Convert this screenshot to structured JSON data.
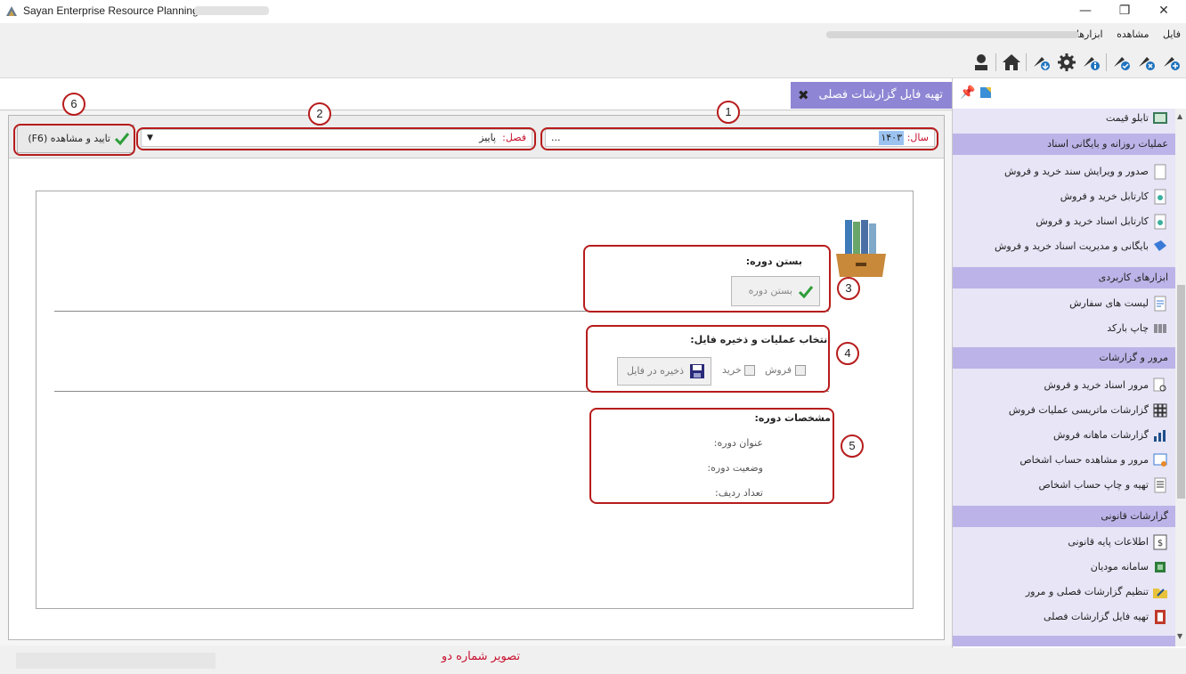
{
  "window": {
    "title": "Sayan Enterprise Resource Planning",
    "minimize": "—",
    "maximize": "❐",
    "close": "✕"
  },
  "menu": [
    "فایل",
    "مشاهده",
    "ابزارها"
  ],
  "toolbar": {
    "icons": [
      "user-icon",
      "home-icon",
      "rocket-download-icon",
      "gear-icon",
      "rocket-info-icon",
      "rocket-check-icon",
      "rocket-x-icon",
      "rocket-add-icon"
    ]
  },
  "tab": {
    "label": "تهیه فایل گزارشات فصلی",
    "close": "✖"
  },
  "criteria": {
    "year_label": "سال:",
    "year_value": "۱۴۰۳",
    "ellipsis": "...",
    "season_label": "فصل:",
    "season_value": "پاییز",
    "confirm_label": "تایید و مشاهده (F6)"
  },
  "sections": {
    "close_period": {
      "title": "بستن دوره:",
      "button": "بستن دوره"
    },
    "select_ops": {
      "title": "انتخاب عملیات و ذخیره فایل:",
      "sale": "فروش",
      "purchase": "خرید",
      "save_button": "ذخیره در فایل"
    },
    "period_info": {
      "title": "مشخصات دوره:",
      "period_title": "عنوان دوره:",
      "period_status": "وضعیت دوره:",
      "row_count": "تعداد ردیف:"
    }
  },
  "annotations": [
    "1",
    "2",
    "3",
    "4",
    "5",
    "6"
  ],
  "sidebar": {
    "top_item": "تابلو قیمت",
    "groups": [
      {
        "title": "عملیات روزانه و بایگانی اسناد",
        "items": [
          "صدور و ویرایش سند خرید و فروش",
          "کارتابل خرید و فروش",
          "کارتابل اسناد خرید و فروش",
          "بایگانی و مدیریت اسناد خرید و فروش"
        ]
      },
      {
        "title": "ابزارهای کاربردی",
        "items": [
          "لیست های سفارش",
          "چاپ بارکد"
        ]
      },
      {
        "title": "مرور و گزارشات",
        "items": [
          "مرور اسناد خرید و فروش",
          "گزارشات ماتریسی عملیات فروش",
          "گزارشات ماهانه فروش",
          "مرور و مشاهده حساب اشخاص",
          "تهیه و چاپ حساب اشخاص"
        ]
      },
      {
        "title": "گزارشات قانونی",
        "items": [
          "اطلاعات پایه قانونی",
          "سامانه مودیان",
          "تنظیم گزارشات فصلی و مرور",
          "تهیه فایل گزارشات فصلی"
        ]
      }
    ]
  },
  "caption": "تصویر شماره دو",
  "colors": {
    "accent": "#8e86d4",
    "group": "#bcb4e8",
    "annotation": "#b71c1c"
  }
}
